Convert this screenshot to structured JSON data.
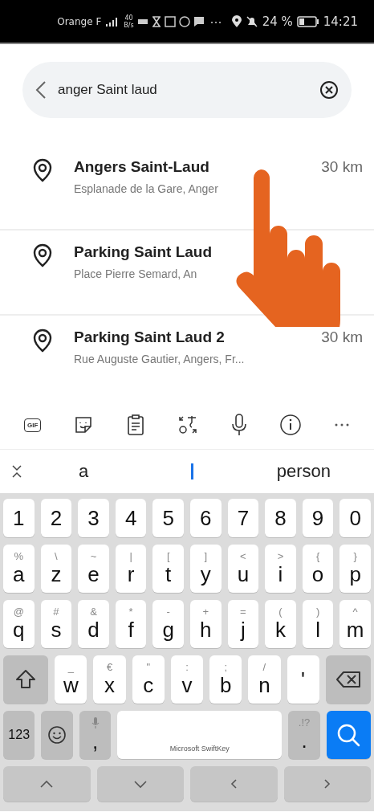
{
  "status_bar": {
    "carrier": "Orange F",
    "speed_value": "40",
    "speed_unit": "B/s",
    "battery": "24 %",
    "time": "14:21"
  },
  "search": {
    "value": "anger Saint laud"
  },
  "results": [
    {
      "title": "Angers Saint-Laud",
      "subtitle": "Esplanade de la Gare, Anger",
      "distance": "30 km"
    },
    {
      "title": "Parking Saint Laud",
      "subtitle": "Place Pierre Semard, An"
    },
    {
      "title": "Parking Saint Laud 2",
      "subtitle": "Rue Auguste Gautier, Angers, Fr...",
      "distance": "30 km"
    }
  ],
  "keyboard_toolbar": [
    {
      "kind": "gif",
      "label": "GIF"
    },
    {
      "kind": "sticker"
    },
    {
      "kind": "clipboard"
    },
    {
      "kind": "translate"
    },
    {
      "kind": "mic"
    },
    {
      "kind": "info"
    },
    {
      "kind": "more"
    }
  ],
  "suggestions": [
    "a",
    "person"
  ],
  "keyboard": [
    [
      {
        "kind": "char",
        "label": "1"
      },
      {
        "kind": "char",
        "label": "2"
      },
      {
        "kind": "char",
        "label": "3"
      },
      {
        "kind": "char",
        "label": "4"
      },
      {
        "kind": "char",
        "label": "5"
      },
      {
        "kind": "char",
        "label": "6"
      },
      {
        "kind": "char",
        "label": "7"
      },
      {
        "kind": "char",
        "label": "8"
      },
      {
        "kind": "char",
        "label": "9"
      },
      {
        "kind": "char",
        "label": "0"
      }
    ],
    [
      {
        "kind": "char",
        "label": "a",
        "alt": "%"
      },
      {
        "kind": "char",
        "label": "z",
        "alt": "\\"
      },
      {
        "kind": "char",
        "label": "e",
        "alt": "~"
      },
      {
        "kind": "char",
        "label": "r",
        "alt": "|"
      },
      {
        "kind": "char",
        "label": "t",
        "alt": "["
      },
      {
        "kind": "char",
        "label": "y",
        "alt": "]"
      },
      {
        "kind": "char",
        "label": "u",
        "alt": "<"
      },
      {
        "kind": "char",
        "label": "i",
        "alt": ">"
      },
      {
        "kind": "char",
        "label": "o",
        "alt": "{"
      },
      {
        "kind": "char",
        "label": "p",
        "alt": "}"
      }
    ],
    [
      {
        "kind": "char",
        "label": "q",
        "alt": "@"
      },
      {
        "kind": "char",
        "label": "s",
        "alt": "#"
      },
      {
        "kind": "char",
        "label": "d",
        "alt": "&"
      },
      {
        "kind": "char",
        "label": "f",
        "alt": "*"
      },
      {
        "kind": "char",
        "label": "g",
        "alt": "-"
      },
      {
        "kind": "char",
        "label": "h",
        "alt": "+"
      },
      {
        "kind": "char",
        "label": "j",
        "alt": "="
      },
      {
        "kind": "char",
        "label": "k",
        "alt": "("
      },
      {
        "kind": "char",
        "label": "l",
        "alt": ")"
      },
      {
        "kind": "char",
        "label": "m",
        "alt": "^"
      }
    ],
    [
      {
        "kind": "shift"
      },
      {
        "kind": "char",
        "label": "w",
        "alt": "_"
      },
      {
        "kind": "char",
        "label": "x",
        "alt": "€"
      },
      {
        "kind": "char",
        "label": "c",
        "alt": "\""
      },
      {
        "kind": "char",
        "label": "v",
        "alt": ":"
      },
      {
        "kind": "char",
        "label": "b",
        "alt": ";"
      },
      {
        "kind": "char",
        "label": "n",
        "alt": "/"
      },
      {
        "kind": "char",
        "label": "'"
      },
      {
        "kind": "backspace"
      }
    ],
    [
      {
        "kind": "num",
        "label": "123"
      },
      {
        "kind": "emoji"
      },
      {
        "kind": "comma",
        "label": ","
      },
      {
        "kind": "space",
        "label": "Microsoft SwiftKey"
      },
      {
        "kind": "period",
        "label": ".",
        "alt": ".!?"
      },
      {
        "kind": "search"
      }
    ],
    [
      {
        "kind": "up"
      },
      {
        "kind": "down"
      },
      {
        "kind": "left"
      },
      {
        "kind": "right"
      }
    ]
  ]
}
